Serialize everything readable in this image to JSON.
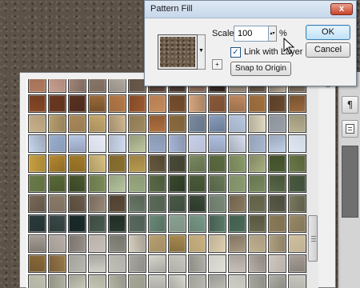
{
  "dialog": {
    "title": "Pattern Fill",
    "close_label": "x",
    "scale_label": "Scale:",
    "scale_value": "100",
    "scale_unit": "%",
    "link_with_layer_label": "Link with Layer",
    "link_with_layer_checked": true,
    "snap_to_origin_label": "Snap to Origin",
    "ok_label": "OK",
    "cancel_label": "Cancel"
  },
  "icons": {
    "panel_paragraph": "¶",
    "check": "✓",
    "arrow_down": "▼",
    "arrow_updown": "▴▾",
    "menu": "▶",
    "new_preset": "+"
  },
  "pattern_picker": {
    "columns": 14,
    "swatch_colors": [
      "#b07a5e",
      "#c9a090",
      "#a3887a",
      "#8c7a6a",
      "#b8b0a6",
      "#6a5a4c",
      "#5c4438",
      "#4a3a30",
      "#8a6a58",
      "#3a2c24",
      "#9a8a78",
      "#6a5a48",
      "#b0a290",
      "#7a6a58",
      "#8a4a28",
      "#6a3820",
      "#5a3222",
      "#9a6a3a",
      "#b67a48",
      "#a05a30",
      "#c48a5a",
      "#7a5030",
      "#d8a880",
      "#8a5a3a",
      "#c08a60",
      "#a07040",
      "#6a4a30",
      "#9a6a40",
      "#c9b28a",
      "#b8a070",
      "#a8885a",
      "#c8aa70",
      "#d2b890",
      "#a08a60",
      "#b07040",
      "#8a6a40",
      "#7a8aa0",
      "#8aa0c0",
      "#b8c8e0",
      "#e0d8c0",
      "#9aa0a8",
      "#b8b090",
      "#c8d8f0",
      "#9ab0d0",
      "#b8c8e8",
      "#e8ecf8",
      "#d0dcf0",
      "#c0c8a0",
      "#98aac8",
      "#a8b8d8",
      "#c8d0e8",
      "#b0c0e0",
      "#d8e0f0",
      "#a8b8d0",
      "#c0d0e8",
      "#e0e8f4",
      "#c8a040",
      "#b88a30",
      "#a07a28",
      "#d8c080",
      "#8a7030",
      "#b89a50",
      "#6a5a40",
      "#4a4a38",
      "#7a8a60",
      "#5a6a40",
      "#8a9a68",
      "#a8b080",
      "#4a5a30",
      "#6a7a48",
      "#6a7a48",
      "#5a6a38",
      "#4a5a30",
      "#7a8a58",
      "#b8c8a0",
      "#98a880",
      "#5a6a48",
      "#3a4a30",
      "#4a5a38",
      "#6a7a58",
      "#8a9a70",
      "#7a8a60",
      "#5a6a48",
      "#4a5a40",
      "#7a6a58",
      "#8a7a68",
      "#6a5a48",
      "#9a8a78",
      "#5a4a38",
      "#6a7a68",
      "#5a6a58",
      "#4a5a48",
      "#3a4a38",
      "#7a8a78",
      "#8a7a60",
      "#6a6a50",
      "#5a5a48",
      "#7a7a60",
      "#2a3a3a",
      "#3a4a48",
      "#1a2a28",
      "#4a5a50",
      "#2a3a30",
      "#5a6a60",
      "#6a8a78",
      "#8aa090",
      "#7a9a88",
      "#5a7a68",
      "#4a6a58",
      "#6a6a50",
      "#8a7a58",
      "#9a8a68",
      "#a8a098",
      "#b8b0a8",
      "#989088",
      "#c8c0b8",
      "#8a8a80",
      "#d8d0c0",
      "#b8a070",
      "#a88a50",
      "#c8b080",
      "#e0d0b0",
      "#a89880",
      "#c0b090",
      "#b0a080",
      "#d0c0a0",
      "#8a6a3a",
      "#9a7a4a",
      "#b8b8b0",
      "#d0d0c8",
      "#c0c0b8",
      "#a8a8a0",
      "#d8d8d0",
      "#c8c8c0",
      "#b0b0a8",
      "#e0e0d8",
      "#c8c0b8",
      "#b8b0a8",
      "#d0c8c0",
      "#a8a098",
      "#c0c0b0",
      "#b0b0a0",
      "#d0d0c0",
      "#c8c8b8",
      "#b8b8a8",
      "#a8a898",
      "#c8c8c0",
      "#d8d8d0",
      "#b8b8b0",
      "#c0c0b8",
      "#d0d0c8",
      "#a8a8a0",
      "#b0b0a8",
      "#c8c8c0"
    ]
  }
}
